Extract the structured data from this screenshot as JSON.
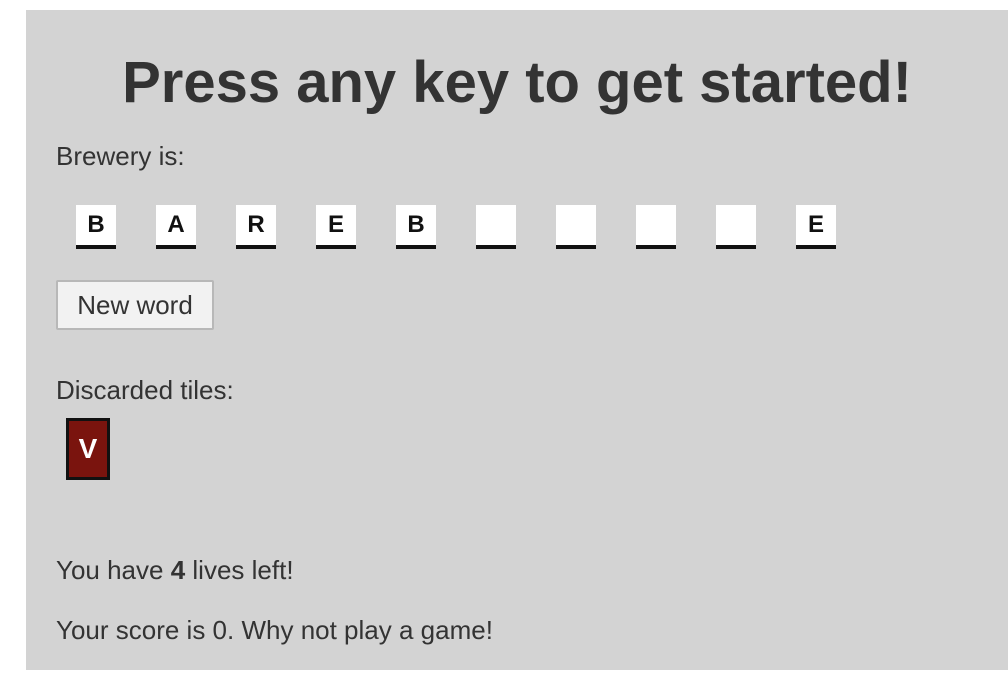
{
  "game": {
    "headline": "Press any key to get started!",
    "word_label": "Brewery is:",
    "word_tiles": [
      "B",
      "A",
      "R",
      "E",
      "B",
      "",
      "",
      "",
      "",
      "E"
    ],
    "new_word_button": "New word",
    "discarded_label": "Discarded tiles:",
    "discarded_tiles": [
      "V"
    ],
    "lives_prefix": "You have ",
    "lives_count": "4",
    "lives_suffix": " lives left!",
    "score_text": "Your score is 0. Why not play a game!"
  },
  "colors": {
    "panel_background": "#d3d3d3",
    "tile_background": "#ffffff",
    "discard_tile_background": "#7a140e",
    "text": "#333333"
  }
}
